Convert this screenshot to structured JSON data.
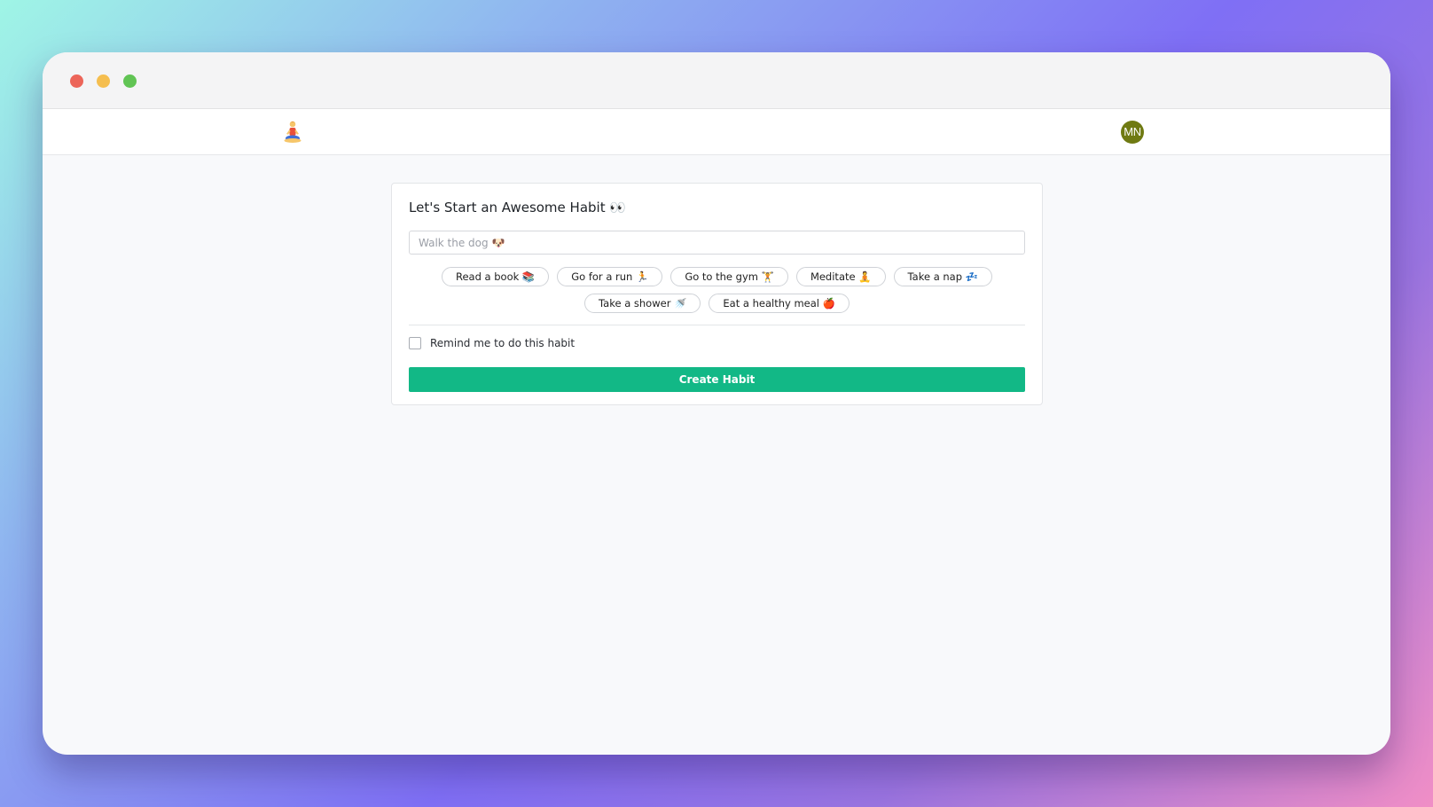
{
  "window": {
    "controls": [
      "close",
      "minimize",
      "maximize"
    ]
  },
  "navbar": {
    "logo_icon": "meditating-person-icon",
    "avatar_initials": "MN",
    "avatar_color": "#6f7a12"
  },
  "form": {
    "title": "Let's Start an Awesome Habit 👀",
    "habit_input": {
      "value": "",
      "placeholder": "Walk the dog 🐶"
    },
    "suggestions": [
      {
        "label": "Read a book 📚"
      },
      {
        "label": "Go for a run 🏃"
      },
      {
        "label": "Go to the gym 🏋️"
      },
      {
        "label": "Meditate 🧘"
      },
      {
        "label": "Take a nap 💤"
      },
      {
        "label": "Take a shower 🚿"
      },
      {
        "label": "Eat a healthy meal 🍎"
      }
    ],
    "reminder": {
      "label": "Remind me to do this habit",
      "checked": false
    },
    "submit_label": "Create Habit"
  },
  "colors": {
    "accent": "#12b886",
    "close": "#ec6559",
    "minimize": "#f5be4f",
    "maximize": "#61c454"
  }
}
